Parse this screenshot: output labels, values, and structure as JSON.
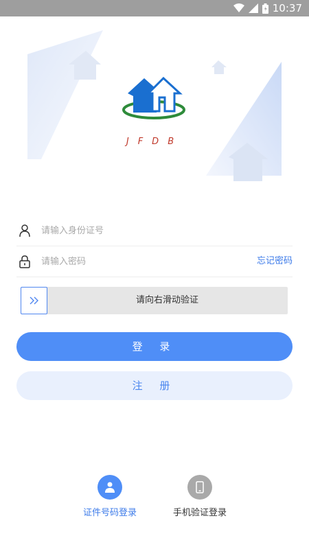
{
  "status_bar": {
    "time": "10:37",
    "icons": [
      "wifi-icon",
      "signal-icon",
      "battery-icon"
    ]
  },
  "hero": {
    "logo_text": "JFDB"
  },
  "form": {
    "id_placeholder": "请输入身份证号",
    "password_placeholder": "请输入密码",
    "forgot_label": "忘记密码",
    "slider_text": "请向右滑动验证"
  },
  "buttons": {
    "login_label": "登 录",
    "register_label": "注 册"
  },
  "login_modes": [
    {
      "label": "证件号码登录",
      "icon": "person-icon",
      "active": true
    },
    {
      "label": "手机验证登录",
      "icon": "phone-icon",
      "active": false
    }
  ],
  "colors": {
    "accent": "#4f8ef7",
    "link": "#3d7be9",
    "inactive": "#a9a9a9",
    "logo_blue": "#1a6fd0",
    "logo_green": "#2e8b3a",
    "logo_red": "#c0392b"
  }
}
